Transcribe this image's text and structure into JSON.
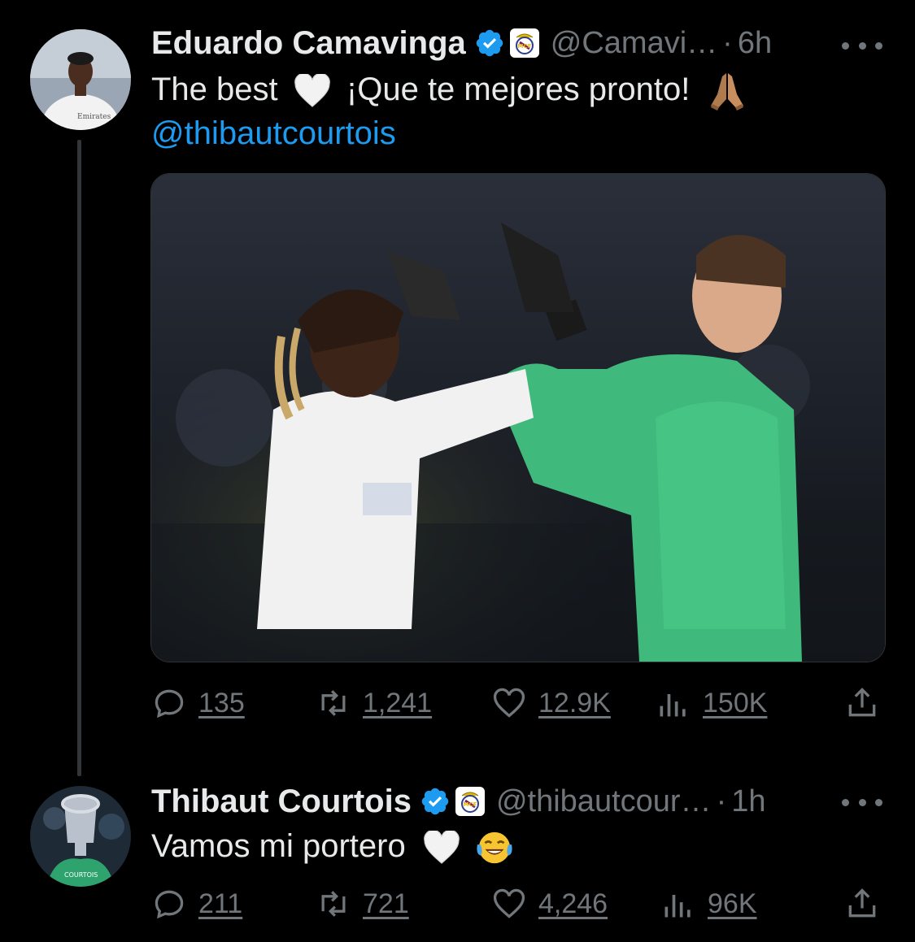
{
  "tweets": [
    {
      "author": {
        "name": "Eduardo Camavinga",
        "handle": "@Camavi…",
        "time": "6h"
      },
      "text_main": "The best",
      "text_after_heart": "¡Que te mejores pronto!",
      "mention": "@thibautcourtois",
      "metrics": {
        "replies": "135",
        "retweets": "1,241",
        "likes": "12.9K",
        "views": "150K"
      }
    },
    {
      "author": {
        "name": "Thibaut Courtois",
        "handle": "@thibautcour…",
        "time": "1h"
      },
      "text_main": "Vamos mi portero",
      "metrics": {
        "replies": "211",
        "retweets": "721",
        "likes": "4,246",
        "views": "96K"
      }
    }
  ],
  "separator": "·",
  "colors": {
    "background": "#000000",
    "text": "#e7e9ea",
    "muted": "#71767b",
    "link": "#1d9bf0",
    "verified": "#1d9bf0"
  },
  "icons": [
    "verified-badge-icon",
    "real-madrid-crest-icon",
    "more-icon",
    "heart-white-emoji",
    "folded-hands-emoji",
    "tears-of-joy-emoji",
    "reply-icon",
    "retweet-icon",
    "like-icon",
    "views-icon",
    "share-icon"
  ]
}
